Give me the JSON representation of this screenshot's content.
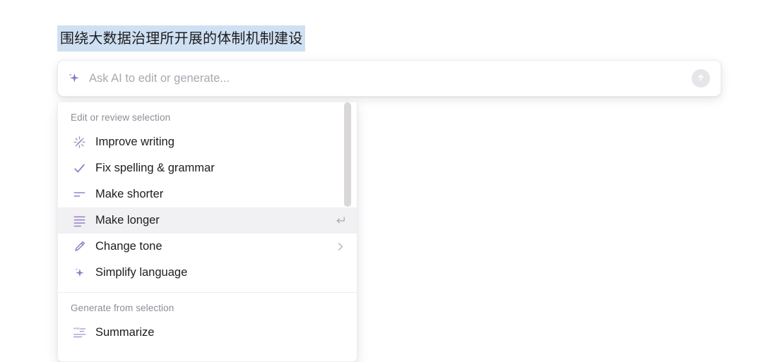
{
  "document": {
    "selected_text": "围绕大数据治理所开展的体制机制建设",
    "selection_color": "#cfe0f3"
  },
  "ai_bar": {
    "placeholder": "Ask AI to edit or generate...",
    "value": "",
    "leading_icon": "sparkle-icon",
    "submit_icon": "arrow-up-circle-icon",
    "accent_color": "#9a86c8"
  },
  "menu": {
    "sections": [
      {
        "title": "Edit or review selection",
        "items": [
          {
            "label": "Improve writing",
            "icon": "sparkle-burst-icon",
            "hint": "",
            "chevron": false,
            "active": false
          },
          {
            "label": "Fix spelling & grammar",
            "icon": "check-icon",
            "hint": "",
            "chevron": false,
            "active": false
          },
          {
            "label": "Make shorter",
            "icon": "lines-short-icon",
            "hint": "",
            "chevron": false,
            "active": false
          },
          {
            "label": "Make longer",
            "icon": "lines-long-icon",
            "hint": "↵",
            "chevron": false,
            "active": true
          },
          {
            "label": "Change tone",
            "icon": "pencil-icon",
            "hint": "",
            "chevron": true,
            "active": false
          },
          {
            "label": "Simplify language",
            "icon": "sparkle-icon",
            "hint": "",
            "chevron": false,
            "active": false
          }
        ]
      },
      {
        "title": "Generate from selection",
        "items": [
          {
            "label": "Summarize",
            "icon": "quote-lines-icon",
            "hint": "",
            "chevron": false,
            "active": false
          }
        ]
      }
    ],
    "scrollbar": {
      "visible": true
    }
  }
}
